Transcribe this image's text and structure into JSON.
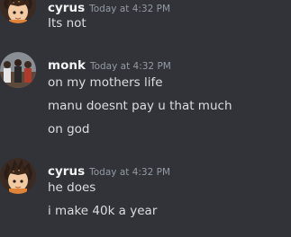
{
  "messages": [
    {
      "username": "cyrus",
      "timestamp": "Today at 4:32 PM",
      "lines": [
        "Its not"
      ],
      "avatar": "cyrus-avatar"
    },
    {
      "username": "monk",
      "timestamp": "Today at 4:32 PM",
      "lines": [
        "on my mothers life",
        "manu doesnt pay u that much",
        "on god"
      ],
      "avatar": "monk-avatar"
    },
    {
      "username": "cyrus",
      "timestamp": "Today at 4:32 PM",
      "lines": [
        "he does",
        "i make 40k a year"
      ],
      "avatar": "cyrus-avatar"
    }
  ],
  "colors": {
    "background": "#313338",
    "username": "#f2f3f5",
    "timestamp": "#949ba4",
    "text": "#dbdee1"
  }
}
